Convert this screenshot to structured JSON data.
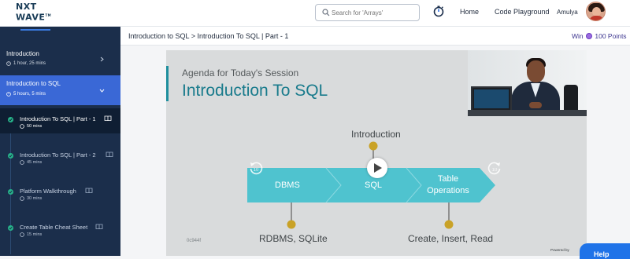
{
  "header": {
    "logo_line1": "NXT",
    "logo_line2": "WAV",
    "logo_line2b": "E",
    "logo_tm": "TM",
    "search_placeholder": "Search for 'Arrays'",
    "nav_home": "Home",
    "nav_code_playground": "Code Playground",
    "user_name": "Amulya",
    "icons": {
      "search": "search-icon",
      "timer": "stopwatch-icon",
      "avatar": "user-avatar"
    }
  },
  "sidebar": {
    "sections": [
      {
        "title": "Introduction",
        "duration": "1 hour, 25 mins",
        "state": "collapsed"
      },
      {
        "title": "Introduction to SQL",
        "duration": "5 hours, 5 mins",
        "state": "expanded"
      }
    ],
    "items": [
      {
        "label": "Introduction To SQL | Part - 1",
        "duration": "50 mins",
        "current": true
      },
      {
        "label": "Introduction To SQL | Part - 2",
        "duration": "45 mins",
        "current": false
      },
      {
        "label": "Platform Walkthrough",
        "duration": "30 mins",
        "current": false
      },
      {
        "label": "Create Table Cheat Sheet",
        "duration": "15 mins",
        "current": false
      }
    ]
  },
  "breadcrumb": "Introduction to SQL > Introduction To SQL | Part - 1",
  "win": {
    "prefix": "Win",
    "points": "100 Points"
  },
  "video": {
    "agenda": "Agenda for Today's Session",
    "title": "Introduction To SQL",
    "node_top": "Introduction",
    "step1": "DBMS",
    "step2": "SQL",
    "step3_line1": "Table",
    "step3_line2": "Operations",
    "bottom_left": "RDBMS, SQLite",
    "bottom_right": "Create, Insert, Read",
    "code": "0c944f",
    "powered": "Powered by"
  },
  "help_label": "Help",
  "colors": {
    "sidebar": "#1b2e4b",
    "active_section": "#3a68d6",
    "teal": "#197b8c",
    "arrow": "#4fc3cf",
    "node": "#c9a227",
    "help": "#1f73e8"
  }
}
